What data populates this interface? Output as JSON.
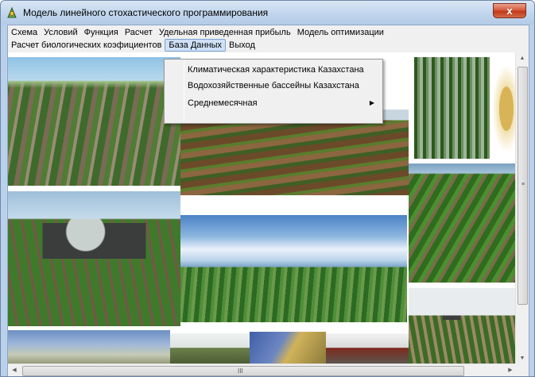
{
  "window": {
    "title": "Модель линейного стохастического программирования",
    "close_label": "x"
  },
  "menu": {
    "row1": [
      "Схема",
      "Условий",
      "Функция",
      "Расчет",
      "Удельная приведенная прибыль",
      "Модель оптимизации"
    ],
    "row2": [
      "Расчет биологических коэфициентов",
      "База Данных",
      "Выход"
    ],
    "active": "База Данных"
  },
  "dropdown": {
    "items": [
      {
        "label": "Климатическая характеристика Казахстана",
        "submenu": false
      },
      {
        "label": "Водохозяйственные бассейны Казахстана",
        "submenu": false
      },
      {
        "label": "Среднемесячная",
        "submenu": true
      }
    ],
    "submenu_arrow": "▶"
  },
  "scrollbars": {
    "up_arrow": "▲",
    "down_arrow": "▼",
    "left_arrow": "◀",
    "right_arrow": "▶",
    "h_grip": "III",
    "v_grip": "≡"
  },
  "colors": {
    "title_gradient_top": "#d9e6f4",
    "close_button": "#c2391a",
    "menu_bg": "#f0f0f0",
    "active_menu_bg": "#cfe0f7"
  }
}
